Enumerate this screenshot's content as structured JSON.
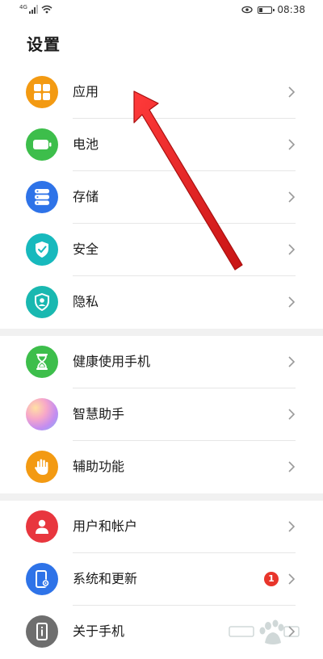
{
  "status_bar": {
    "network": "4G",
    "time": "08:38"
  },
  "page_title": "设置",
  "groups": [
    {
      "items": [
        {
          "label": "应用",
          "icon": "apps-grid-icon",
          "color": "#f39a12"
        },
        {
          "label": "电池",
          "icon": "battery-icon",
          "color": "#3dbe4b"
        },
        {
          "label": "存储",
          "icon": "storage-icon",
          "color": "#2e73e8"
        },
        {
          "label": "安全",
          "icon": "shield-check-icon",
          "color": "#17b9bd"
        },
        {
          "label": "隐私",
          "icon": "privacy-shield-icon",
          "color": "#19b8b0"
        }
      ]
    },
    {
      "items": [
        {
          "label": "健康使用手机",
          "icon": "hourglass-icon",
          "color": "#3dbe4b"
        },
        {
          "label": "智慧助手",
          "icon": "assistant-orb-icon",
          "color": "#d987e4"
        },
        {
          "label": "辅助功能",
          "icon": "hand-icon",
          "color": "#f39a12"
        }
      ]
    },
    {
      "items": [
        {
          "label": "用户和帐户",
          "icon": "user-icon",
          "color": "#e8363e"
        },
        {
          "label": "系统和更新",
          "icon": "phone-settings-icon",
          "color": "#2e73e8",
          "badge": "1"
        },
        {
          "label": "关于手机",
          "icon": "phone-info-icon",
          "color": "#6e6e6e"
        }
      ]
    }
  ],
  "accent_colors": {
    "arrow": "#e51d1d",
    "badge": "#e8352b"
  }
}
